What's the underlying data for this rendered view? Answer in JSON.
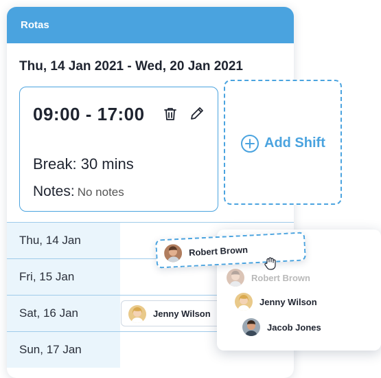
{
  "panel": {
    "title": "Rotas"
  },
  "date_range": "Thu, 14 Jan 2021 - Wed, 20 Jan 2021",
  "shift": {
    "time": "09:00 - 17:00",
    "break_label": "Break:",
    "break_value": "30 mins",
    "notes_label": "Notes:",
    "notes_value": "No notes"
  },
  "add_shift_label": "Add Shift",
  "days": [
    {
      "label": "Thu, 14 Jan"
    },
    {
      "label": "Fri, 15 Jan"
    },
    {
      "label": "Sat, 16 Jan"
    },
    {
      "label": "Sun, 17 Jan"
    }
  ],
  "assignment": {
    "name": "Jenny Wilson"
  },
  "dragging": {
    "name": "Robert Brown"
  },
  "staff_list": [
    {
      "name": "Robert Brown",
      "state": "dragged-away"
    },
    {
      "name": "Jenny Wilson",
      "state": "available"
    },
    {
      "name": "Jacob Jones",
      "state": "available"
    }
  ],
  "colors": {
    "accent": "#4aa3df",
    "header_bg": "#4aa3df",
    "day_bg": "#eaf5fc",
    "text": "#1f2430"
  }
}
